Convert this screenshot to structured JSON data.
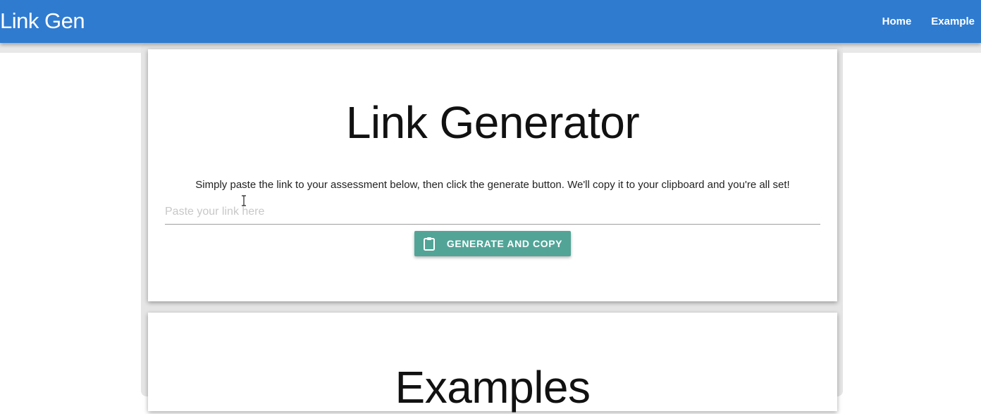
{
  "navbar": {
    "brand": "Link Gen",
    "links": [
      "Home",
      "Example"
    ]
  },
  "generator": {
    "title": "Link Generator",
    "instructions": "Simply paste the link to your assessment below, then click the generate button. We'll copy it to your clipboard and you're all set!",
    "input_placeholder": "Paste your link here",
    "input_value": "",
    "button_label": "GENERATE AND COPY",
    "button_icon": "clipboard-icon"
  },
  "examples": {
    "title": "Examples"
  },
  "colors": {
    "navbar": "#2f7bd0",
    "button": "#52a497"
  }
}
